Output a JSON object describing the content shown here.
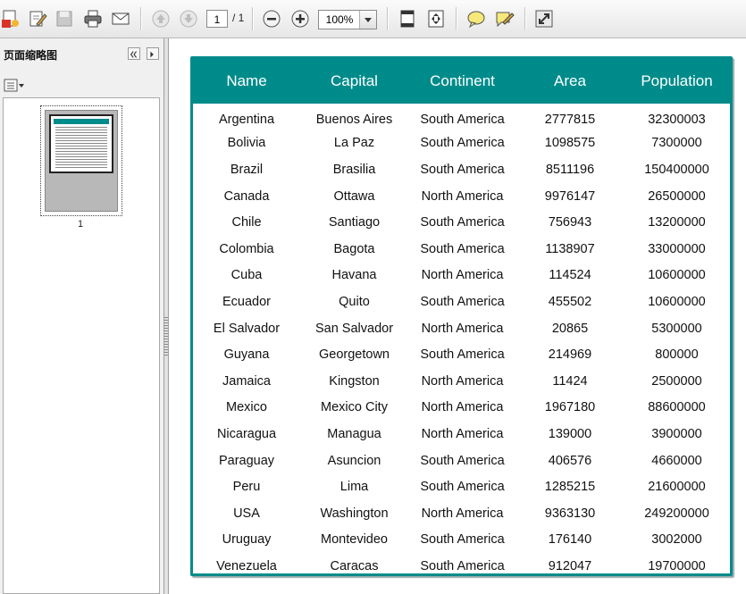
{
  "toolbar": {
    "current_page": "1",
    "total_pages": "/ 1",
    "zoom": "100%"
  },
  "sidebar": {
    "title": "页面缩略图",
    "thumbnail_label": "1"
  },
  "table": {
    "headers": [
      "Name",
      "Capital",
      "Continent",
      "Area",
      "Population"
    ],
    "rows": [
      [
        "Argentina",
        "Buenos Aires",
        "South America",
        "2777815",
        "32300003"
      ],
      [
        "Bolivia",
        "La Paz",
        "South America",
        "1098575",
        "7300000"
      ],
      [
        "Brazil",
        "Brasilia",
        "South America",
        "8511196",
        "150400000"
      ],
      [
        "Canada",
        "Ottawa",
        "North America",
        "9976147",
        "26500000"
      ],
      [
        "Chile",
        "Santiago",
        "South America",
        "756943",
        "13200000"
      ],
      [
        "Colombia",
        "Bagota",
        "South America",
        "1138907",
        "33000000"
      ],
      [
        "Cuba",
        "Havana",
        "North America",
        "114524",
        "10600000"
      ],
      [
        "Ecuador",
        "Quito",
        "South America",
        "455502",
        "10600000"
      ],
      [
        "El Salvador",
        "San Salvador",
        "North America",
        "20865",
        "5300000"
      ],
      [
        "Guyana",
        "Georgetown",
        "South America",
        "214969",
        "800000"
      ],
      [
        "Jamaica",
        "Kingston",
        "North America",
        "11424",
        "2500000"
      ],
      [
        "Mexico",
        "Mexico City",
        "North America",
        "1967180",
        "88600000"
      ],
      [
        "Nicaragua",
        "Managua",
        "North America",
        "139000",
        "3900000"
      ],
      [
        "Paraguay",
        "Asuncion",
        "South America",
        "406576",
        "4660000"
      ],
      [
        "Peru",
        "Lima",
        "South America",
        "1285215",
        "21600000"
      ],
      [
        "USA",
        "Washington",
        "North America",
        "9363130",
        "249200000"
      ],
      [
        "Uruguay",
        "Montevideo",
        "South America",
        "176140",
        "3002000"
      ],
      [
        "Venezuela",
        "Caracas",
        "South America",
        "912047",
        "19700000"
      ]
    ]
  }
}
